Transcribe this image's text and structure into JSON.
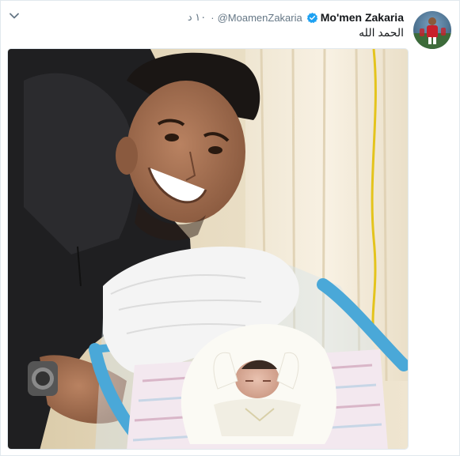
{
  "tweet": {
    "display_name": "Mo'men Zakaria",
    "handle": "@MoamenZakaria",
    "time": "١٠ د",
    "separator": "·",
    "text": "الحمد الله",
    "menu_icon": "chevron-down-icon",
    "verified_icon": "verified-badge-icon"
  },
  "colors": {
    "verified": "#1da1f2",
    "text_secondary": "#657786",
    "text_primary": "#14171a"
  }
}
